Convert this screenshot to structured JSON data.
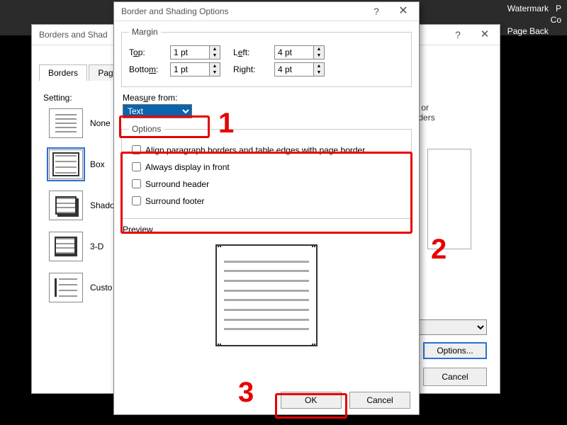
{
  "ribbon": {
    "watermark": "Watermark",
    "p": "P",
    "co": "Co",
    "pageback": "Page Back"
  },
  "dlg1": {
    "title": "Borders and Shad",
    "tabs": {
      "borders": "Borders",
      "page": "Pag"
    },
    "setting_label": "Setting:",
    "settings": {
      "none": "None",
      "box": "Box",
      "shadow": "Shado",
      "threeD": "3-D",
      "custom": "Custo"
    },
    "preview_hint_a": "low or",
    "preview_hint_b": "borders",
    "options_btn": "Options...",
    "cancel": "Cancel"
  },
  "dlg2": {
    "title": "Border and Shading Options",
    "margin_legend": "Margin",
    "top_lbl": "Top:",
    "bottom_lbl": "Bottom:",
    "left_lbl": "Left:",
    "right_lbl": "Right:",
    "top": "1 pt",
    "bottom": "1 pt",
    "left": "4 pt",
    "right": "4 pt",
    "measure_lbl": "Measure from:",
    "measure_val": "Text",
    "options_legend": "Options",
    "opt1": "Align paragraph borders and table edges with page border",
    "opt2": "Always display in front",
    "opt3": "Surround header",
    "opt4": "Surround footer",
    "preview_lbl": "Preview",
    "ok": "OK",
    "cancel": "Cancel"
  },
  "callouts": {
    "n1": "1",
    "n2": "2",
    "n3": "3"
  }
}
